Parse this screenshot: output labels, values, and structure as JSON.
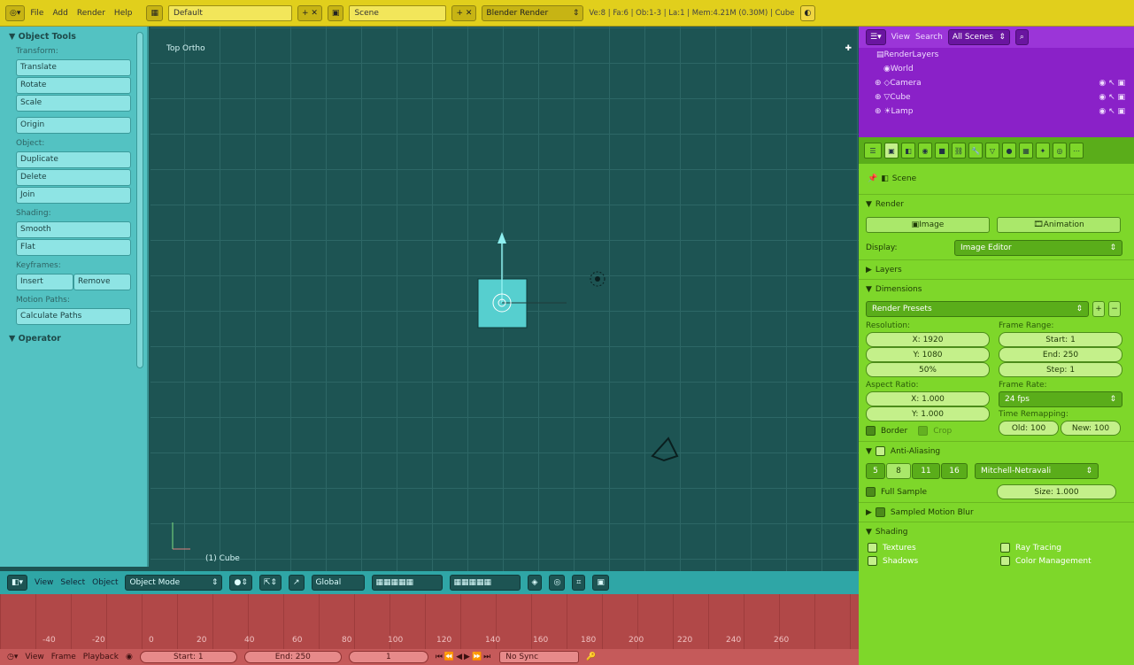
{
  "topbar": {
    "menu": [
      "File",
      "Add",
      "Render",
      "Help"
    ],
    "layout": "Default",
    "scene": "Scene",
    "engine": "Blender Render",
    "stats": "Ve:8 | Fa:6 | Ob:1-3 | La:1 | Mem:4.21M (0.30M) | Cube"
  },
  "tools": {
    "title": "Object Tools",
    "transform_label": "Transform:",
    "translate": "Translate",
    "rotate": "Rotate",
    "scale": "Scale",
    "origin": "Origin",
    "object_label": "Object:",
    "duplicate": "Duplicate",
    "delete": "Delete",
    "join": "Join",
    "shading_label": "Shading:",
    "smooth": "Smooth",
    "flat": "Flat",
    "keyframes_label": "Keyframes:",
    "insert": "Insert",
    "remove": "Remove",
    "motion_label": "Motion Paths:",
    "calculate": "Calculate Paths",
    "operator": "Operator"
  },
  "viewport": {
    "view_label": "Top Ortho",
    "object_label": "(1) Cube"
  },
  "vheader": {
    "menu": [
      "View",
      "Select",
      "Object"
    ],
    "mode": "Object Mode",
    "orientation": "Global"
  },
  "timeline": {
    "ticks": [
      "-40",
      "-20",
      "0",
      "20",
      "40",
      "60",
      "80",
      "100",
      "120",
      "140",
      "160",
      "180",
      "200",
      "220",
      "240",
      "260"
    ],
    "menu": [
      "View",
      "Frame",
      "Playback"
    ],
    "start": "Start: 1",
    "end": "End: 250",
    "current": "1",
    "sync": "No Sync"
  },
  "outliner": {
    "menu": [
      "View",
      "Search"
    ],
    "filter": "All Scenes",
    "items": [
      "RenderLayers",
      "World",
      "Camera",
      "Cube",
      "Lamp"
    ]
  },
  "props": {
    "scene": "Scene",
    "render_panel": "Render",
    "image_btn": "Image",
    "anim_btn": "Animation",
    "display_label": "Display:",
    "display_value": "Image Editor",
    "layers_panel": "Layers",
    "dimensions_panel": "Dimensions",
    "presets": "Render Presets",
    "resolution_label": "Resolution:",
    "res_x": "X: 1920",
    "res_y": "Y: 1080",
    "res_pct": "50%",
    "range_label": "Frame Range:",
    "start": "Start: 1",
    "end": "End: 250",
    "step": "Step: 1",
    "aspect_label": "Aspect Ratio:",
    "asp_x": "X: 1.000",
    "asp_y": "Y: 1.000",
    "rate_label": "Frame Rate:",
    "fps": "24 fps",
    "remap_label": "Time Remapping:",
    "old": "Old: 100",
    "new": "New: 100",
    "border": "Border",
    "crop": "Crop",
    "aa_panel": "Anti-Aliasing",
    "aa_samples": [
      "5",
      "8",
      "11",
      "16"
    ],
    "aa_filter": "Mitchell-Netravali",
    "full_sample": "Full Sample",
    "size": "Size: 1.000",
    "motion_blur": "Sampled Motion Blur",
    "shading_panel": "Shading",
    "textures": "Textures",
    "raytracing": "Ray Tracing",
    "shadows": "Shadows",
    "color_mgmt": "Color Management"
  },
  "colors": {
    "topbar": "#e1cf1c",
    "toolshelf": "#53c2c2",
    "viewport": "#1d5453",
    "timeline": "#b14848",
    "outliner": "#8a21c8",
    "properties": "#7ed72a"
  }
}
